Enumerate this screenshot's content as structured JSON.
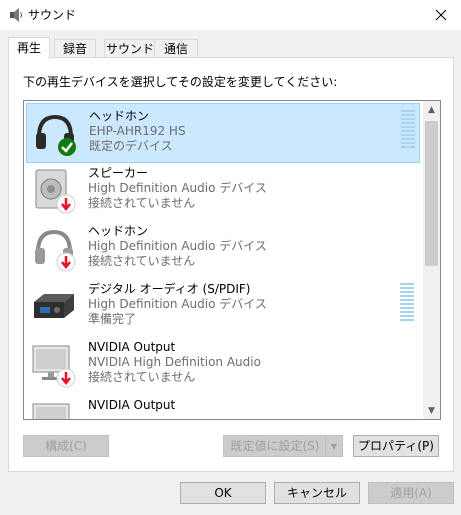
{
  "window": {
    "title": "サウンド",
    "close_glyph": "✕"
  },
  "tabs": [
    {
      "label": "再生",
      "active": true
    },
    {
      "label": "録音",
      "active": false
    },
    {
      "label": "サウンド",
      "active": false
    },
    {
      "label": "通信",
      "active": false
    }
  ],
  "panel": {
    "instruction": "下の再生デバイスを選択してその設定を変更してください:"
  },
  "devices": [
    {
      "name": "ヘッドホン",
      "desc": "EHP-AHR192 HS",
      "status": "既定のデバイス",
      "icon": "headphones-icon",
      "badge": "default-check-icon",
      "selected": true,
      "level_meter": true
    },
    {
      "name": "スピーカー",
      "desc": "High Definition Audio デバイス",
      "status": "接続されていません",
      "icon": "speaker-icon",
      "badge": "unplugged-icon",
      "selected": false,
      "level_meter": false
    },
    {
      "name": "ヘッドホン",
      "desc": "High Definition Audio デバイス",
      "status": "接続されていません",
      "icon": "headphones-icon",
      "badge": "unplugged-icon",
      "selected": false,
      "level_meter": false
    },
    {
      "name": "デジタル オーディオ (S/PDIF)",
      "desc": "High Definition Audio デバイス",
      "status": "準備完了",
      "icon": "digital-audio-icon",
      "badge": "",
      "selected": false,
      "level_meter": true
    },
    {
      "name": "NVIDIA Output",
      "desc": "NVIDIA High Definition Audio",
      "status": "接続されていません",
      "icon": "monitor-icon",
      "badge": "unplugged-icon",
      "selected": false,
      "level_meter": false
    },
    {
      "name": "NVIDIA Output",
      "desc": "",
      "status": "",
      "icon": "monitor-icon",
      "badge": "",
      "selected": false,
      "level_meter": false
    }
  ],
  "panel_buttons": {
    "configure": "構成(C)",
    "set_default": "既定値に設定(S)",
    "properties": "プロパティ(P)"
  },
  "dialog_buttons": {
    "ok": "OK",
    "cancel": "キャンセル",
    "apply": "適用(A)"
  },
  "colors": {
    "selection_bg": "#cce8ff",
    "selection_border": "#99d1ff",
    "check_green": "#107c10",
    "unplugged_red": "#e81123",
    "level_meter": "#a6d4ec"
  }
}
